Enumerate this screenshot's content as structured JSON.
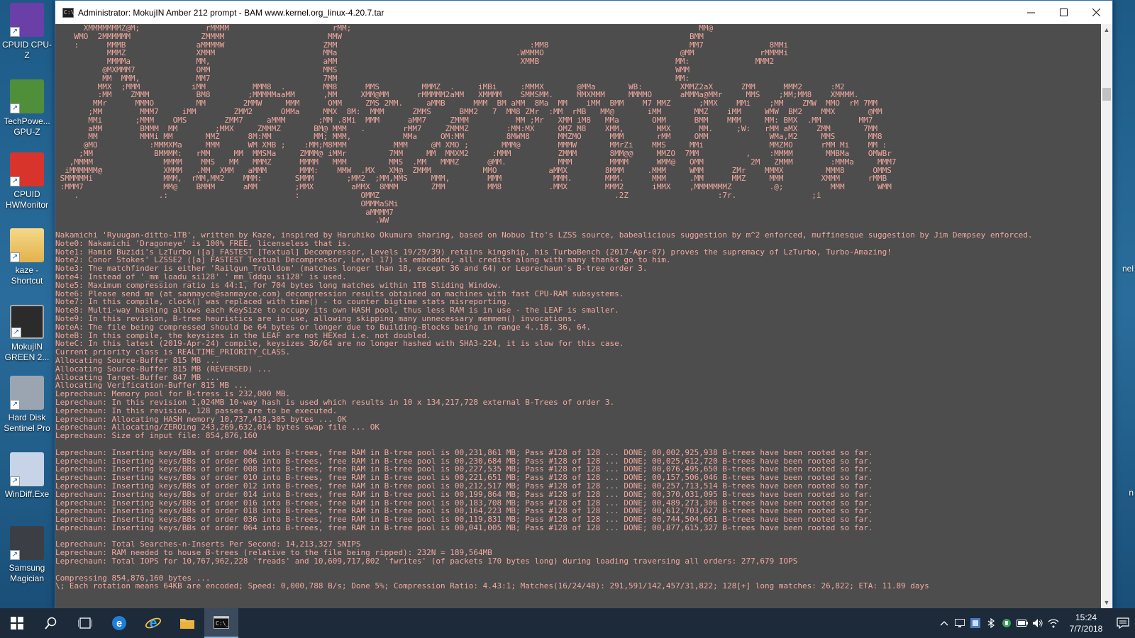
{
  "window": {
    "title": "Administrator: MokujIN Amber 212 prompt - BAM  www.kernel.org_linux-4.20.7.tar",
    "app_icon_text": "C:\\"
  },
  "desktop_icons": [
    {
      "label": "CPUID CPU-Z",
      "icon": "cpu-z-icon",
      "color": "#6a3fa8"
    },
    {
      "label": "TechPowe... GPU-Z",
      "icon": "gpu-z-icon",
      "color": "#4f8f3a"
    },
    {
      "label": "CPUID HWMonitor",
      "icon": "hwmonitor-icon",
      "color": "#d9342b"
    },
    {
      "label": "kaze - Shortcut",
      "icon": "folder-icon",
      "color": "#e8c46a"
    },
    {
      "label": "MokujIN GREEN 2...",
      "icon": "console-icon",
      "color": "#2b2b2b"
    },
    {
      "label": "Hard Disk Sentinel Pro",
      "icon": "hard-disk-icon",
      "color": "#9aa5b1"
    },
    {
      "label": "WinDiff.Exe",
      "icon": "windiff-icon",
      "color": "#c7d3e6"
    },
    {
      "label": "Samsung Magician",
      "icon": "ssd-icon",
      "color": "#3b3f45"
    }
  ],
  "right_edge": [
    "nel",
    "n"
  ],
  "ascii_art": [
    "      XMMMMMMMZ@M;              rMMMM                      rMM;                                                                          MM@",
    "    WMO  2MMMMMM               ZMMMM                      MMW                                                                          BMM",
    "    :      MMMB               aMMMMW                     ZMM                                         :MM8                              MM7              8MMi",
    "           MMMZ               XMMM                       MMa                                      .WMMMO                             @MM              rMMMMi",
    "           MMMMa              MM,                        aMM                                       XMMB                             MM:              MMM2",
    "          @MXMMM7             OMM                        MMS                                                                        WMM",
    "          MM  MMM,            MM7                        7MM                                                                        MM:",
    "         MMX  ;MMM           iMM          MMM8  .        MM8      MMS         MMMZ  .     iMBi     :MMMX       @MMa       WB:        XMMZ2aX      ZMM      MMM2      :M2",
    "         :MM    ZMMM          BM8        ;MMMMMaaMM      ,MM     XMM@MM      rMMMMM2aMM   XMMMM    SMMSMM.     MMXMMM     MMMMO      aMMMa@MMr     MMS    ;MM;MM8    XMMMM.",
    "        MMr      MMMO         MM        2MMW     MMM      OMM     ZMS 2MM.     aMMB      MMM  BM aMM  8Ma  MM    iMM  BMM    M7 MMZ      ;MMX    MMi    ;MM    ZMW  MMO  rM 7MM",
    "       ;MM        MMM7     iMM        ZMM2      OMMa     MMX  8M:  MMM      ZMMS      BMM2   7  MM8 ZMr  :MM  rMB   MM@       iMM       MMZ    iMM     WMW  BM2    MMX       @MM",
    "       MMi       ;MMM    OMS        ZMM7     aMMM       ;MM .8Mi  MMM      aMM7     ZMMM          MM ;Mr   XMM iM8   MMa       OMM      BMM    MMM     MM: BMX  .MM        MM7",
    "       aMM        BMMM  MM        ;MMX     ZMMMZ       BM@ MMM   .        rMM7     ZMMMZ        :MM:MX     OMZ M8    XMM,       MMX      MM.     ;W:   rMM aMX    ZMM       7MM",
    "       MM         MMMi MM       MMZ      8M:MM         MM; MMM,           MMa     OM:MM         8MWM8      MMZMO      MMM       rMM     OMM             WMa,M2     MMS       MM8",
    "      @MO           :MMMXMa     MMM      WM XMB ;    :MM;M8MMM          MMM     @M XMO ;       MMM@        MMMW       MMrZi    MMS     MMi              MMZMO      rMM Mi    MM :",
    "     ;MM             BMMMM:   rMM     MM  MMSMa     ZMMM@ iMMr         7MM     MM  MMXM2     :MMM          ZMMM       8MM@@     MMZO  7MM          ,    :MMMM       MMBMa    OMWBr",
    "   ,MMMM               MMMM    MMS   MM   MMMZ      MMMM   MMM         MMS  .MM   MMMZ      @MM.           MMM        MMMM      WMM@   OMM          2M   ZMMM        :MMMa     MMM7",
    "  iMMMMMM@             XMMM   .MM  XMM   aMMM       MMM:    MMW  .MX   XM@  ZMMM           MMO           aMMX        8MMM     .MMM     WMM      ZMr    MMMX         MMM8      OMMS",
    " SMMMMMi               MMM,  rMM,MM2    MMM:       SMMM       ;MM2  ;MM,MMS     MMM,        MMM           MMM.       MMM.      MMM     .MM      MMZ     MMM        XMMM      rMMB",
    " :MMM7                 MM@    BMMM      aMM        ;MMX        aMMX  8MMM       ZMM         MM8          .MMX        MMM2      iMMX    ,MMMMMMMZ        .@;          MMM       WMM",
    "    .                 .:                           :             OMMZ                                                  .2Z                   :7r.                ;i",
    "                                                                 OMMMaSMi",
    "                                                                  aMMMM7",
    "                                                                    .WW"
  ],
  "log_lines": [
    "Nakamichi 'Ryuugan-ditto-1TB', written by Kaze, inspired by Haruhiko Okumura sharing, based on Nobuo Ito's LZSS source, babealicious suggestion by m^2 enforced, muffinesque suggestion by Jim Dempsey enforced.",
    "Note0: Nakamichi 'Dragoneye' is 100% FREE, licenseless that is.",
    "Note1: Hamid Buzidi's LzTurbo ([a] FASTEST [Textual] Decompressor, Levels 19/29/39) retains kingship, his TurboBench (2017-Apr-07) proves the supremacy of LzTurbo, Turbo-Amazing!",
    "Note2: Conor Stokes' LZSSE2 ([a] FASTEST Textual Decompressor, Level 17) is embedded, all credits along with many thanks go to him.",
    "Note3: The matchfinder is either 'Railgun_Trolldom' (matches longer than 18, except 36 and 64) or Leprechaun's B-tree order 3.",
    "Note4: Instead of '_mm_loadu_si128' '_mm_lddqu_si128' is used.",
    "Note5: Maximum compression ratio is 44:1, for 704 bytes long matches within 1TB Sliding Window.",
    "Note6: Please send me (at sanmayce@sanmayce.com) decompression results obtained on machines with fast CPU-RAM subsystems.",
    "Note7: In this compile, clock() was replaced with time() - to counter bigtime stats misreporting.",
    "Note8: Multi-way hashing allows each KeySize to occupy its own HASH pool, thus less RAM is in use - the LEAF is smaller.",
    "Note9: In this revision, B-tree heuristics are in use, allowing skipping many unnecessary memmem() invocations.",
    "NoteA: The file being compressed should be 64 bytes or longer due to Building-Blocks being in range 4..18, 36, 64.",
    "NoteB: In this compile, the keysizes in the LEAF are not HEXed i.e. not doubled.",
    "NoteC: In this latest (2019-Apr-24) compile, keysizes 36/64 are no longer hashed with SHA3-224, it is slow for this case.",
    "Current priority class is REALTIME_PRIORITY_CLASS.",
    "Allocating Source-Buffer 815 MB ...",
    "Allocating Source-Buffer 815 MB (REVERSED) ...",
    "Allocating Target-Buffer 847 MB ...",
    "Allocating Verification-Buffer 815 MB ...",
    "Leprechaun: Memory pool for B-tress is 232,000 MB.",
    "Leprechaun: In this revision 1,024MB 10-way hash is used which results in 10 x 134,217,728 external B-Trees of order 3.",
    "Leprechaun: In this revision, 128 passes are to be executed.",
    "Leprechaun: Allocating HASH memory 10,737,418,305 bytes ... OK",
    "Leprechaun: Allocating/ZEROing 243,269,632,014 bytes swap file ... OK",
    "Leprechaun: Size of input file: 854,876,160",
    "",
    "Leprechaun: Inserting keys/BBs of order 004 into B-trees, free RAM in B-tree pool is 00,231,861 MB; Pass #128 of 128 ... DONE; 00,002,925,938 B-trees have been rooted so far.",
    "Leprechaun: Inserting keys/BBs of order 006 into B-trees, free RAM in B-tree pool is 00,230,684 MB; Pass #128 of 128 ... DONE; 00,025,612,720 B-trees have been rooted so far.",
    "Leprechaun: Inserting keys/BBs of order 008 into B-trees, free RAM in B-tree pool is 00,227,535 MB; Pass #128 of 128 ... DONE; 00,076,495,650 B-trees have been rooted so far.",
    "Leprechaun: Inserting keys/BBs of order 010 into B-trees, free RAM in B-tree pool is 00,221,651 MB; Pass #128 of 128 ... DONE; 00,157,506,046 B-trees have been rooted so far.",
    "Leprechaun: Inserting keys/BBs of order 012 into B-trees, free RAM in B-tree pool is 00,212,517 MB; Pass #128 of 128 ... DONE; 00,257,713,514 B-trees have been rooted so far.",
    "Leprechaun: Inserting keys/BBs of order 014 into B-trees, free RAM in B-tree pool is 00,199,864 MB; Pass #128 of 128 ... DONE; 00,370,031,095 B-trees have been rooted so far.",
    "Leprechaun: Inserting keys/BBs of order 016 into B-trees, free RAM in B-tree pool is 00,183,708 MB; Pass #128 of 128 ... DONE; 00,489,273,306 B-trees have been rooted so far.",
    "Leprechaun: Inserting keys/BBs of order 018 into B-trees, free RAM in B-tree pool is 00,164,223 MB; Pass #128 of 128 ... DONE; 00,612,703,627 B-trees have been rooted so far.",
    "Leprechaun: Inserting keys/BBs of order 036 into B-trees, free RAM in B-tree pool is 00,119,831 MB; Pass #128 of 128 ... DONE; 00,744,504,661 B-trees have been rooted so far.",
    "Leprechaun: Inserting keys/BBs of order 064 into B-trees, free RAM in B-tree pool is 00,041,005 MB; Pass #128 of 128 ... DONE; 00,877,615,327 B-trees have been rooted so far.",
    "",
    "Leprechaun: Total Searches-n-Inserts Per Second: 14,213,327 SNIPS",
    "Leprechaun: RAM needed to house B-trees (relative to the file being ripped): 232N = 189,564MB",
    "Leprechaun: Total IOPS for 10,767,962,228 'freads' and 10,609,717,802 'fwrites' (of packets 170 bytes long) during loading traversing all orders: 277,679 IOPS",
    "",
    "Compressing 854,876,160 bytes ...",
    "\\; Each rotation means 64KB are encoded; Speed: 0,000,788 B/s; Done 5%; Compression Ratio: 4.43:1; Matches(16/24/48): 291,591/142,457/31,822; 128[+] long matches: 26,822; ETA: 11.89 days"
  ],
  "taskbar": {
    "time": "15:24",
    "date": "7/7/2018"
  }
}
